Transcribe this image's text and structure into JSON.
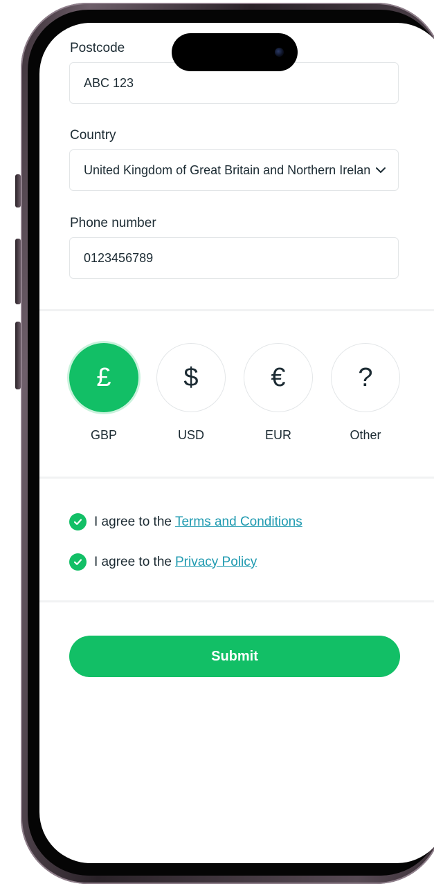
{
  "form": {
    "postcode": {
      "label": "Postcode",
      "value": "ABC 123"
    },
    "country": {
      "label": "Country",
      "value": "United Kingdom of Great Britain and Northern Ireland"
    },
    "phone": {
      "label": "Phone number",
      "value": "0123456789"
    }
  },
  "currency": {
    "selected": "GBP",
    "options": [
      {
        "symbol": "£",
        "label": "GBP"
      },
      {
        "symbol": "$",
        "label": "USD"
      },
      {
        "symbol": "€",
        "label": "EUR"
      },
      {
        "symbol": "?",
        "label": "Other"
      }
    ]
  },
  "agreements": {
    "terms": {
      "prefix": "I agree to the",
      "link": "Terms and Conditions",
      "checked": true
    },
    "privacy": {
      "prefix": "I agree to the",
      "link": "Privacy Policy",
      "checked": true
    }
  },
  "actions": {
    "submit_label": "Submit"
  },
  "colors": {
    "accent": "#12bf66",
    "link": "#1f9ab0",
    "text": "#1c2b33",
    "border": "#e2e5e7"
  },
  "icons": {
    "country_dropdown": "chevron-down-icon",
    "agreement_check": "check-circle-icon"
  }
}
